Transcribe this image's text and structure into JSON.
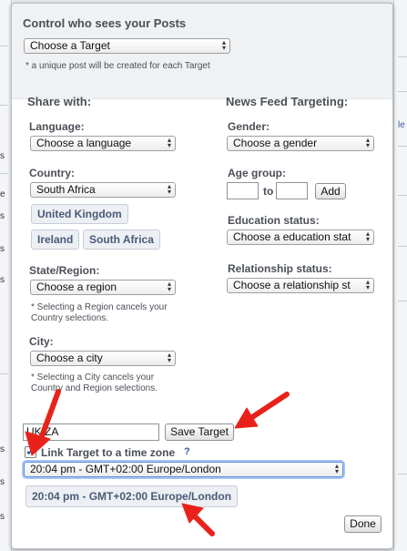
{
  "background": {
    "left_texts": [
      "s",
      "e",
      "s",
      "s",
      "s",
      "s",
      "s",
      "s"
    ],
    "right_text": "le"
  },
  "popup": {
    "title": "Control who sees your Posts",
    "target_select": "Choose a Target",
    "target_note": "* a unique post will be created for each Target",
    "share_with": {
      "heading": "Share with:",
      "language_label": "Language:",
      "language_select": "Choose a language",
      "country_label": "Country:",
      "country_select": "South Africa",
      "country_chips": [
        "United Kingdom",
        "Ireland",
        "South Africa"
      ],
      "region_label": "State/Region:",
      "region_select": "Choose a region",
      "region_note": "* Selecting a Region cancels your Country selections.",
      "city_label": "City:",
      "city_select": "Choose a city",
      "city_note": "* Selecting a City cancels your Country and Region selections."
    },
    "news_feed": {
      "heading": "News Feed Targeting:",
      "gender_label": "Gender:",
      "gender_select": "Choose a gender",
      "age_label": "Age group:",
      "age_to": "to",
      "age_from_value": "",
      "age_to_value": "",
      "add_button": "Add",
      "education_label": "Education status:",
      "education_select": "Choose a education stat",
      "relationship_label": "Relationship status:",
      "relationship_select": "Choose a relationship st"
    },
    "target_name_value": "UK ZA",
    "save_target_button": "Save Target",
    "link_timezone_label": "Link Target to a time zone",
    "link_timezone_checked": true,
    "help_mark": "?",
    "timezone_select": "20:04 pm - GMT+02:00 Europe/London",
    "timezone_chip": "20:04 pm - GMT+02:00 Europe/London",
    "done_button": "Done"
  },
  "annotation_color": "#e8221b"
}
